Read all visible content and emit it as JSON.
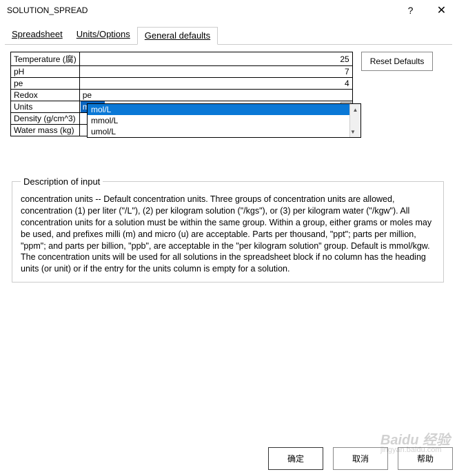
{
  "window": {
    "title": "SOLUTION_SPREAD",
    "help_icon": "?",
    "close_icon": "✕"
  },
  "tabs": {
    "spreadsheet": "Spreadsheet",
    "units_options": "Units/Options",
    "general_defaults": "General defaults"
  },
  "params": {
    "temperature_label": "Temperature (腐)",
    "temperature_value": "25",
    "ph_label": "pH",
    "ph_value": "7",
    "pe_label": "pe",
    "pe_value": "4",
    "redox_label": "Redox",
    "redox_value": "pe",
    "units_label": "Units",
    "units_value": "mol/L",
    "density_label": "Density (g/cm^3)",
    "density_value": "",
    "water_mass_label": "Water mass (kg)",
    "water_mass_value": ""
  },
  "units_dropdown": {
    "opt0": "mol/L",
    "opt1": "mmol/L",
    "opt2": "umol/L"
  },
  "buttons": {
    "reset_defaults": "Reset Defaults",
    "ok": "确定",
    "cancel": "取消",
    "help": "帮助"
  },
  "description": {
    "legend": "Description of input",
    "text": "concentration units -- Default concentration units. Three groups of concentration units are allowed, concentration (1) per liter (\"/L\"), (2) per kilogram solution (\"/kgs\"), or (3) per kilogram water (\"/kgw\"). All concentration units for a solution must be within the same group. Within a group, either grams or moles may be used, and prefixes milli (m) and micro (u) are acceptable. Parts per thousand, \"ppt\"; parts per million, \"ppm\"; and parts per billion, \"ppb\", are acceptable in the \"per kilogram solution\" group. Default is mmol/kgw.  The concentration units will be used for all solutions in the spreadsheet block if no column has the heading units (or unit) or if the entry for the units column is empty for a solution."
  },
  "watermark": {
    "main": "Baidu 经验",
    "sub": "jingyan.baidu.com"
  }
}
